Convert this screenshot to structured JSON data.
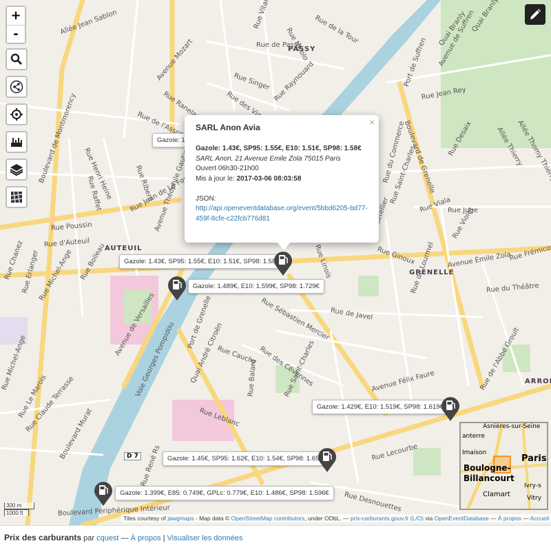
{
  "controls": {
    "zoom_in": "+",
    "zoom_out": "-"
  },
  "streets": [
    "Allée Jean Sablon",
    "Rue de Passy",
    "Rue Vital",
    "Rue Nicolo",
    "Rue de la Tour",
    "Avenue Mozart",
    "Rue Singer",
    "Rue Raynouard",
    "Rue des Vignes",
    "Rue Ranelagh",
    "Rue de l'Assomption",
    "Boulevard de Montmorency",
    "Rue Henri Heine",
    "Rue Raffet",
    "Rue Ribera",
    "Rue Jean de La Fontaine",
    "Avenue Théophile Gautier",
    "Rue Poussin",
    "Rue d'Auteuil",
    "Rue Chanez",
    "Rue Erlanger",
    "Rue Michel-Ange",
    "Rue Boileau",
    "Avenue de Versailles",
    "Voie Georges Pompidou",
    "Quai André Citroën",
    "Port de Grenelle",
    "Rue Cauchy",
    "Rue Sébastien Mercier",
    "Rue des Cévennes",
    "Rue Saint-Charles",
    "Rue Balard",
    "Rue Leblanc",
    "Rue de Javel",
    "Avenue Émile Zola",
    "Rue du Théâtre",
    "Rue Linois",
    "Rue Saint-Charles",
    "Rue Viala",
    "Rue Juge",
    "Rue Violet",
    "Boulevard de Grenelle",
    "Rue Desaix",
    "Quai Branly",
    "Rue Jean Rey",
    "Port de Suffren",
    "Avenue de Suffren",
    "Rue du Commerce",
    "Rue Letellier",
    "Rue Lecourbe",
    "Rue Desnouettes",
    "Boulevard Périphérique Intérieur",
    "Rue Claude Terrasse",
    "Boulevard Murat",
    "Rue Le Marois",
    "Rue Michel-Ange",
    "Avenue Félix Faure",
    "Rue de l'Abbé Groult",
    "Rue de Lourmel",
    "Rue Frémicourt",
    "Rue René Rs",
    "Rue Ginoux",
    "Allée Thierry",
    "Allée Thomy Thierry",
    "Quai Branly"
  ],
  "districts": [
    "PASSY",
    "AUTEUIL",
    "GRENELLE",
    "ARRON"
  ],
  "route_badge": "D 7",
  "tooltips": [
    "Gazole: 1.4",
    "Gazole: 1.43€, SP95: 1.55€, E10: 1.51€, SP98: 1.58€",
    "Gazole: 1.489€, E10: 1.599€, SP98: 1.729€",
    "Gazole: 1.429€, E10: 1.519€, SP98: 1.619€",
    "Gazole: 1.45€, SP95: 1.62€, E10: 1.54€, SP98: 1.65€",
    "Gazole: 1.399€, E85: 0.749€, GPLc: 0.779€, E10: 1.486€, SP98: 1.596€"
  ],
  "popup": {
    "close": "×",
    "title": "SARL Anon Avia",
    "prices": "Gazole: 1.43€, SP95: 1.55€, E10: 1.51€, SP98: 1.58€",
    "address": "SARL Anon, 21 Avenue Emile Zola 75015 Paris",
    "hours": "Ouvert 06h30-21h00",
    "updated_label": "Mis à jour le: ",
    "updated_value": "2017-03-06 08:03:58",
    "json_label": "JSON:",
    "json_url": "http://api.openeventdatabase.org/event/5bbd6205-bd77-459f-8cfe-c22fcb776d81"
  },
  "minimap": {
    "labels": [
      "Asnières-sur-Seine",
      "anterre",
      "Imaison",
      "Paris",
      "Boulogne-",
      "Billancourt",
      "Ivry-s",
      "Vitry",
      "Clamart"
    ]
  },
  "scale": {
    "metric": "300 m",
    "imperial": "1000 ft"
  },
  "attribution": {
    "tiles_prefix": "Tiles courtesy of ",
    "tiles_link": "jawgmaps",
    "data_prefix": " - Map data © ",
    "osm_link": "OpenStreetMap contributors",
    "odbl": ", under ODbL. — ",
    "prix_link": "prix-carburants.gouv.fr (L/O)",
    "via": " via ",
    "oed_link": "OpenEventDatabase",
    "sep1": " — ",
    "about_link": "À propos",
    "sep2": " — ",
    "home_link": "Accueil"
  },
  "footer": {
    "title": "Prix des carburants",
    "by": " par ",
    "author": "cquest",
    "sep1": " — ",
    "about": "À propos",
    "sep2": " | ",
    "visualize": "Visualiser les données"
  }
}
